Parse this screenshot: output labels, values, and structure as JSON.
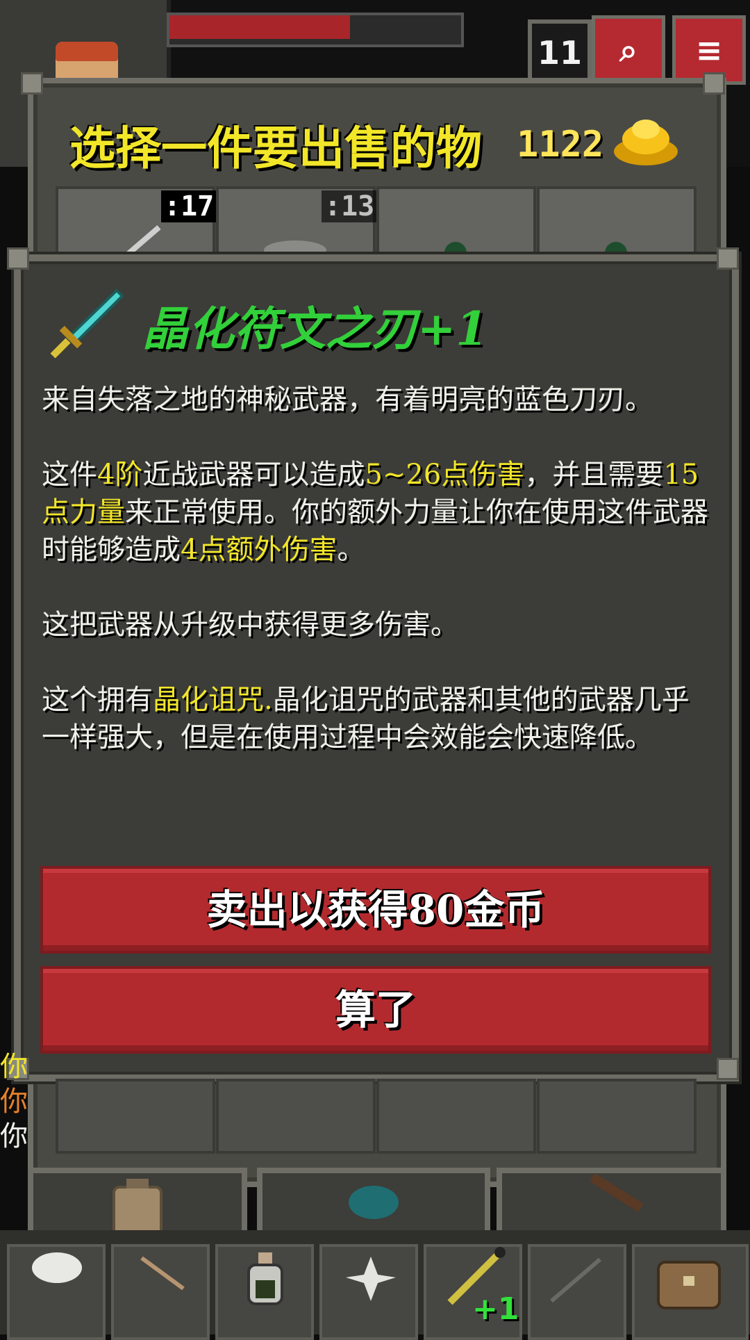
{
  "hud": {
    "depth": "11",
    "hp_fraction": 0.62,
    "journal_icon": "search-journal-icon",
    "menu_icon": "menu-icon"
  },
  "shop": {
    "title": "选择一件要出售的物",
    "gold": "1122",
    "gold_icon": "gold-pile-icon",
    "slots": [
      {
        "qty": ":17",
        "icon": "sword-icon"
      },
      {
        "qty": ":13",
        "icon": "stone-icon"
      },
      {
        "qty": "",
        "icon": "potion-icon"
      },
      {
        "qty": "",
        "icon": "potion-icon"
      }
    ]
  },
  "item": {
    "icon": "crystal-sword-icon",
    "name": "晶化符文之刃+1",
    "para1": "来自失落之地的神秘武器，有着明亮的蓝色刀刃。",
    "para2_a": "这件",
    "para2_tier": "4阶",
    "para2_b": "近战武器可以造成",
    "para2_dmg": "5~26点伤害",
    "para2_c": "，并且需要",
    "para2_str": "15点力量",
    "para2_d": "来正常使用。你的额外力量让你在使用这件武器时能够造成",
    "para2_extra": "4点额外伤害",
    "para2_e": "。",
    "para3": "这把武器从升级中获得更多伤害。",
    "para4_a": "这个拥有",
    "para4_curse": "晶化诅咒.",
    "para4_b": "晶化诅咒的武器和其他的武器几乎一样强大，但是在使用过程中会效能会快速降低。"
  },
  "buttons": {
    "sell": "卖出以获得80金币",
    "cancel": "算了"
  },
  "log": [
    "你",
    "你",
    "你"
  ],
  "toolbar": {
    "upgrade_badge": "+1"
  },
  "colors": {
    "highlight": "#f2e629",
    "item_name": "#32d03a",
    "button_red": "#b32a2e",
    "panel": "#3c3c38"
  }
}
